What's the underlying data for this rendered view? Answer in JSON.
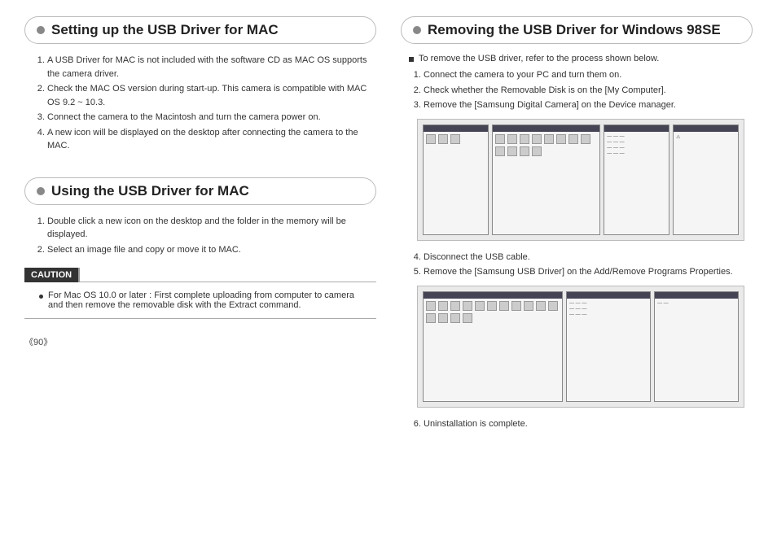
{
  "left": {
    "section1": {
      "title": "Setting up the USB Driver for MAC",
      "steps": [
        "A USB Driver for MAC is not included with the software CD as MAC OS supports the camera driver.",
        "Check the MAC OS version during start-up. This camera is compatible with MAC OS 9.2 ~ 10.3.",
        "Connect the camera to the Macintosh and turn the camera power on.",
        "A new icon will be displayed on the desktop after connecting the camera to the MAC."
      ]
    },
    "section2": {
      "title": "Using the USB Driver for MAC",
      "steps": [
        "Double click a new icon on the desktop and the folder in the memory will be displayed.",
        "Select an image file and copy or move it to MAC."
      ]
    },
    "caution": {
      "label": "CAUTION",
      "text": "For Mac OS 10.0 or later : First complete uploading from computer to camera and then remove the removable disk with the Extract command."
    }
  },
  "right": {
    "section": {
      "title": "Removing the USB Driver for Windows 98SE",
      "intro": "To remove the USB driver, refer to the process shown below.",
      "steps_a": [
        "Connect the camera to your PC and turn them on.",
        "Check whether the Removable Disk is on the [My Computer].",
        "Remove the [Samsung Digital Camera] on the Device manager."
      ],
      "steps_b": [
        "Disconnect the USB cable.",
        "Remove the [Samsung USB Driver] on the Add/Remove Programs Properties."
      ],
      "steps_c": [
        "Uninstallation is complete."
      ]
    }
  },
  "page_number": "《90》"
}
